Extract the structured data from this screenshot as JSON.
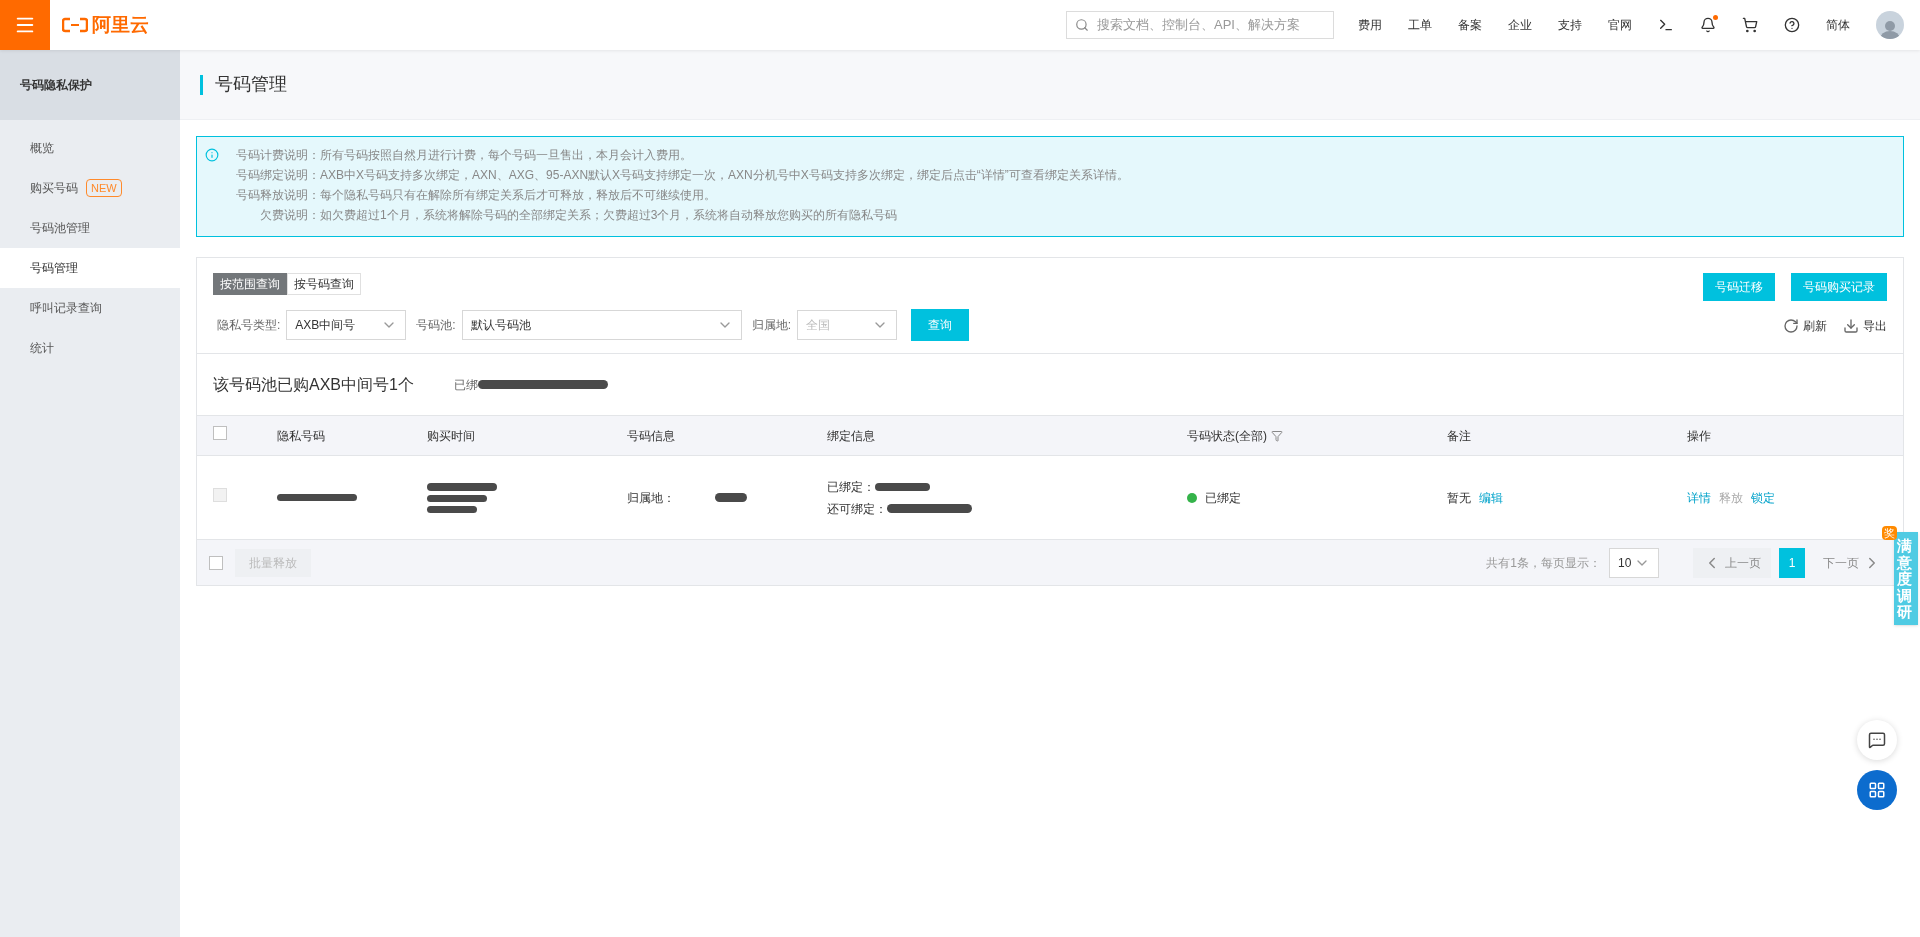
{
  "topbar": {
    "logo": "阿里云",
    "search_placeholder": "搜索文档、控制台、API、解决方案",
    "nav": [
      "费用",
      "工单",
      "备案",
      "企业",
      "支持",
      "官网"
    ],
    "notification_dot": true,
    "language": "简体"
  },
  "sidebar": {
    "title": "号码隐私保护",
    "items": [
      {
        "label": "概览",
        "selected": false
      },
      {
        "label": "购买号码",
        "badge": "NEW",
        "selected": false
      },
      {
        "label": "号码池管理",
        "selected": false
      },
      {
        "label": "号码管理",
        "selected": true
      },
      {
        "label": "呼叫记录查询",
        "selected": false
      },
      {
        "label": "统计",
        "selected": false
      }
    ]
  },
  "page_title": "号码管理",
  "notice": {
    "lines": [
      {
        "label": "号码计费说明：",
        "text": "所有号码按照自然月进行计费，每个号码一旦售出，本月会计入费用。"
      },
      {
        "label": "号码绑定说明：",
        "text": "AXB中X号码支持多次绑定，AXN、AXG、95-AXN默认X号码支持绑定一次，AXN分机号中X号码支持多次绑定，绑定后点击“详情”可查看绑定关系详情。"
      },
      {
        "label": "号码释放说明：",
        "text": "每个隐私号码只有在解除所有绑定关系后才可释放，释放后不可继续使用。"
      },
      {
        "label": "欠费说明：",
        "text": "如欠费超过1个月，系统将解除号码的全部绑定关系；欠费超过3个月，系统将自动释放您购买的所有隐私号码"
      }
    ]
  },
  "query": {
    "tabs": [
      {
        "label": "按范围查询",
        "selected": true
      },
      {
        "label": "按号码查询",
        "selected": false
      }
    ],
    "buttons": [
      "号码迁移",
      "号码购买记录"
    ],
    "filters": [
      {
        "label": "隐私号类型:",
        "value": "AXB中间号",
        "disabled": false
      },
      {
        "label": "号码池:",
        "value": "默认号码池",
        "disabled": false
      },
      {
        "label": "归属地:",
        "value": "全国",
        "disabled": true
      }
    ],
    "search_button": "查询",
    "actions": [
      {
        "kind": "refresh",
        "label": "刷新"
      },
      {
        "kind": "export",
        "label": "导出"
      }
    ]
  },
  "summary": {
    "text": "该号码池已购AXB中间号1个",
    "bound_label": "已绑"
  },
  "table": {
    "columns": [
      {
        "label": "隐私号码",
        "filter": false
      },
      {
        "label": "购买时间",
        "filter": false
      },
      {
        "label": "号码信息",
        "filter": false
      },
      {
        "label": "绑定信息",
        "filter": false
      },
      {
        "label": "号码状态(全部)",
        "filter": true
      },
      {
        "label": "备注",
        "filter": false
      },
      {
        "label": "操作",
        "filter": false
      }
    ],
    "header_checked": false,
    "rows": [
      {
        "checked": false,
        "disabled": true,
        "location_label": "归属地：",
        "bound_label": "已绑定：",
        "remaining_label": "还可绑定：",
        "status": "已绑定",
        "color": "#35b34a",
        "remark": "暂无",
        "remark_action": "编辑",
        "actions": [
          {
            "label": "详情",
            "disabled": false
          },
          {
            "label": "释放",
            "disabled": true
          },
          {
            "label": "锁定",
            "disabled": false
          }
        ]
      }
    ]
  },
  "footer": {
    "checked": false,
    "batch_button": "批量释放",
    "batch_disabled": true,
    "total": "共有1条，每页显示：",
    "page_size": "10",
    "prev": "上一页",
    "prev_disabled": true,
    "pages": [
      {
        "label": "1",
        "selected": true
      }
    ],
    "next": "下一页",
    "next_disabled": true
  },
  "survey": {
    "badge": "奖",
    "text": "满意度调研"
  }
}
